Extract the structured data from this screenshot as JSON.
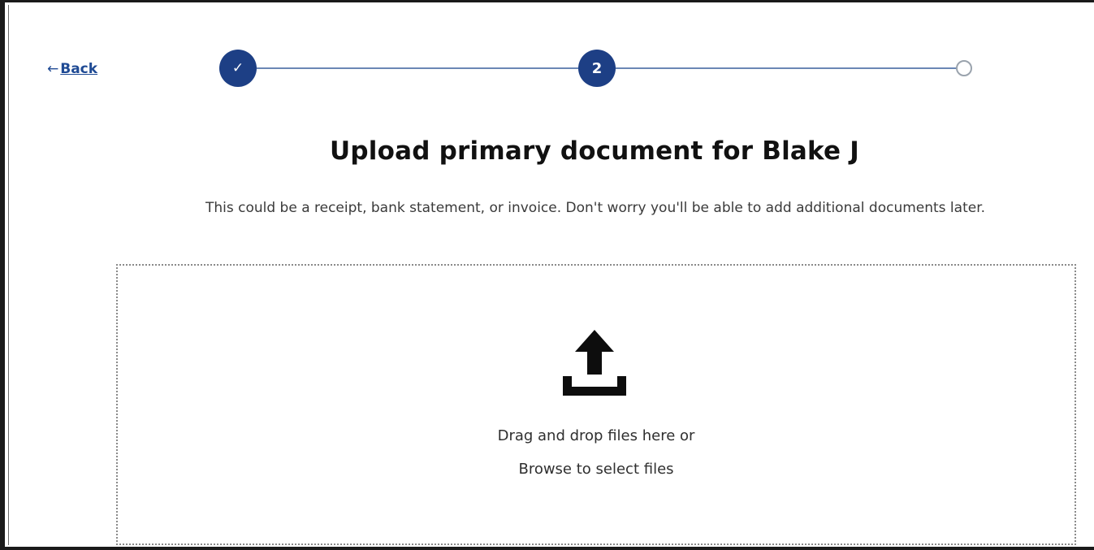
{
  "navigation": {
    "back_arrow": "←",
    "back_label": "Back"
  },
  "stepper": {
    "steps": [
      {
        "label": "✓",
        "state": "complete"
      },
      {
        "label": "2",
        "state": "current"
      },
      {
        "label": "",
        "state": "upcoming"
      }
    ],
    "accent_color": "#1d3f85"
  },
  "main": {
    "title": "Upload primary document for Blake J",
    "description": "This could be a receipt, bank statement, or invoice. Don't worry you'll be able to add additional documents later."
  },
  "upload": {
    "icon": "upload-icon",
    "drag_text": "Drag and drop files here or",
    "browse_text": "Browse to select files"
  }
}
